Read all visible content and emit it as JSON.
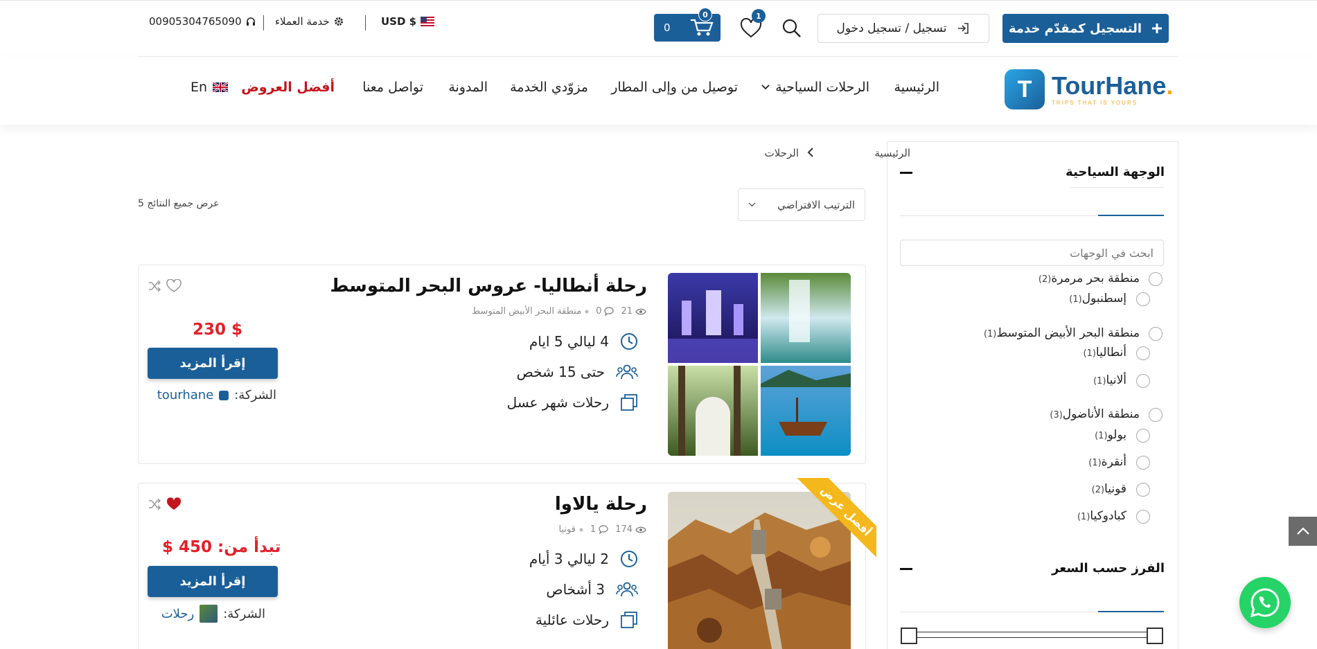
{
  "header": {
    "register_provider": "التسجيل كمقدّم خدمة",
    "login": "تسجيل / تسجيل دخول",
    "wishlist_count": "1",
    "cart_count": "0",
    "cart_total": "0",
    "currency": "USD $",
    "customer_service": "خدمة العملاء",
    "phone": "00905304765090"
  },
  "logo": {
    "name": "TourHane",
    "dot": ".",
    "tagline": "TRIPS THAT IS YOURS"
  },
  "nav": {
    "home": "الرئيسية",
    "tours": "الرحلات السياحية",
    "airport": "توصيل من وإلى المطار",
    "providers": "مزوّدي الخدمة",
    "blog": "المدونة",
    "contact": "تواصل معنا",
    "offers": "أفضل العروض",
    "language": "En"
  },
  "breadcrumb": {
    "home": "الرئيسية",
    "current": "الرحلات"
  },
  "toolbar": {
    "sort": "الترتيب الافتراضي",
    "results": "عرض جميع النتائج 5"
  },
  "sidebar": {
    "destination_title": "الوجهة السياحية",
    "search_placeholder": "ابحث في الوجهات",
    "destinations": [
      {
        "label": "منطقة بحر مرمرة",
        "count": "(2)"
      },
      {
        "label": "إسطنبول",
        "count": "(1)"
      },
      {
        "label": "منطقة البحر الأبيض المتوسط",
        "count": "(1)"
      },
      {
        "label": "أنطاليا",
        "count": "(1)"
      },
      {
        "label": "ألانيا",
        "count": "(1)"
      },
      {
        "label": "منطقة الأناضول",
        "count": "(3)"
      },
      {
        "label": "بولو",
        "count": "(1)"
      },
      {
        "label": "أنقرة",
        "count": "(1)"
      },
      {
        "label": "قونيا",
        "count": "(2)"
      },
      {
        "label": "كبادوكيا",
        "count": "(1)"
      }
    ],
    "price_title": "الفرز حسب السعر"
  },
  "cards": [
    {
      "title": "رحلة أنطاليا- عروس البحر المتوسط",
      "views": "21",
      "comments": "0",
      "region": "منطقة البحر الأبيض المتوسط",
      "duration": "4 ليالي 5 ايام",
      "people": "حتى 15 شخص",
      "category": "رحلات شهر عسل",
      "price": "$ 230",
      "read_more": "إقرأ المزيد",
      "company_label": "الشركة:",
      "company": "tourhane"
    },
    {
      "title": "رحلة يالاوا",
      "views": "174",
      "comments": "1",
      "region": "قونيا",
      "duration": "2 ليالي 3 أيام",
      "people": "3 أشخاص",
      "category": "رحلات عائلية",
      "price": "تبدأ من: 450 $",
      "read_more": "إقرأ المزيد",
      "company_label": "الشركة:",
      "company": "رحلات",
      "ribbon": "أفضل عرض"
    }
  ],
  "colors": {
    "brand": "#1b5f99",
    "accent": "#f4a81d",
    "price": "#e4202a",
    "offers": "#c3151c",
    "whatsapp": "#25d366"
  }
}
